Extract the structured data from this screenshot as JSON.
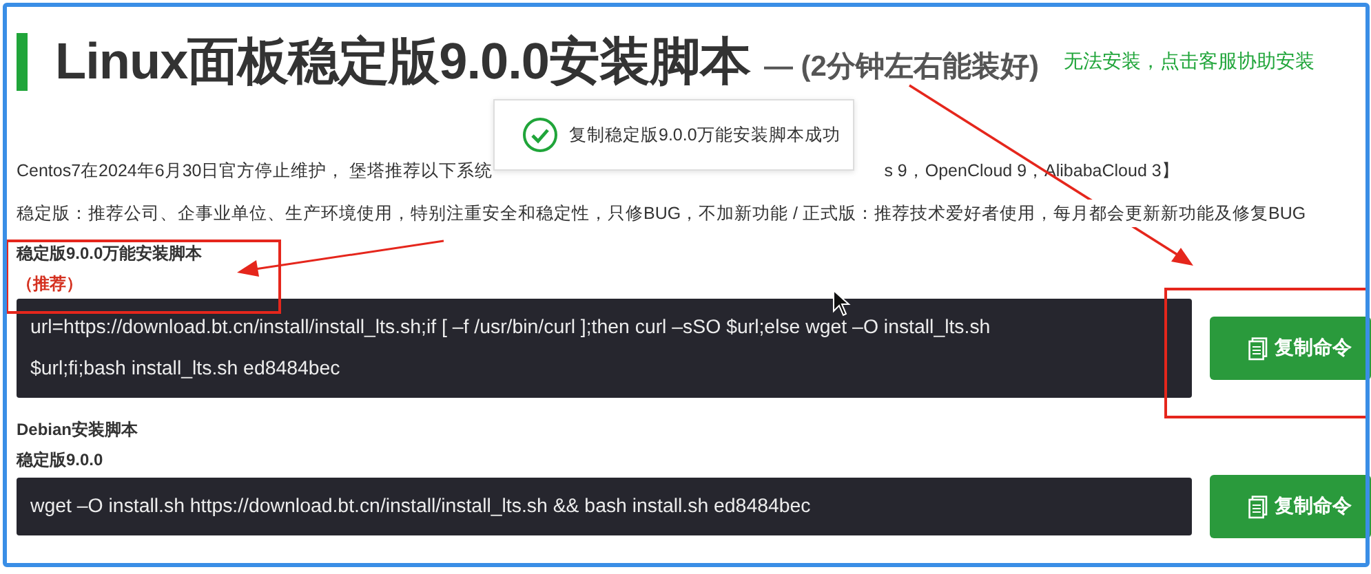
{
  "title": {
    "main": "Linux面板稳定版9.0.0安装脚本",
    "sub": "— (2分钟左右能装好)",
    "help_link": "无法安装，点击客服协助安装"
  },
  "toast": {
    "message": "复制稳定版9.0.0万能安装脚本成功"
  },
  "notice": {
    "before_toast": "Centos7在2024年6月30日官方停止维护， 堡塔推荐以下系统",
    "after_toast": "s 9，OpenCloud 9，AlibabaCloud 3】"
  },
  "description": "稳定版：推荐公司、企事业单位、生产环境使用，特别注重安全和稳定性，只修BUG，不加新功能 / 正式版：推荐技术爱好者使用，每月都会更新新功能及修复BUG",
  "scripts": [
    {
      "heading": "稳定版9.0.0万能安装脚本",
      "tag": "（推荐）",
      "lines": [
        "url=https://download.bt.cn/install/install_lts.sh;if [ –f /usr/bin/curl ];then curl –sSO $url;else wget –O install_lts.sh",
        "$url;fi;bash install_lts.sh ed8484bec"
      ],
      "button": "复制命令"
    },
    {
      "heading": "Debian安装脚本",
      "tag": "稳定版9.0.0",
      "lines": [
        "wget –O install.sh https://download.bt.cn/install/install_lts.sh && bash install.sh ed8484bec"
      ],
      "button": "复制命令"
    }
  ]
}
